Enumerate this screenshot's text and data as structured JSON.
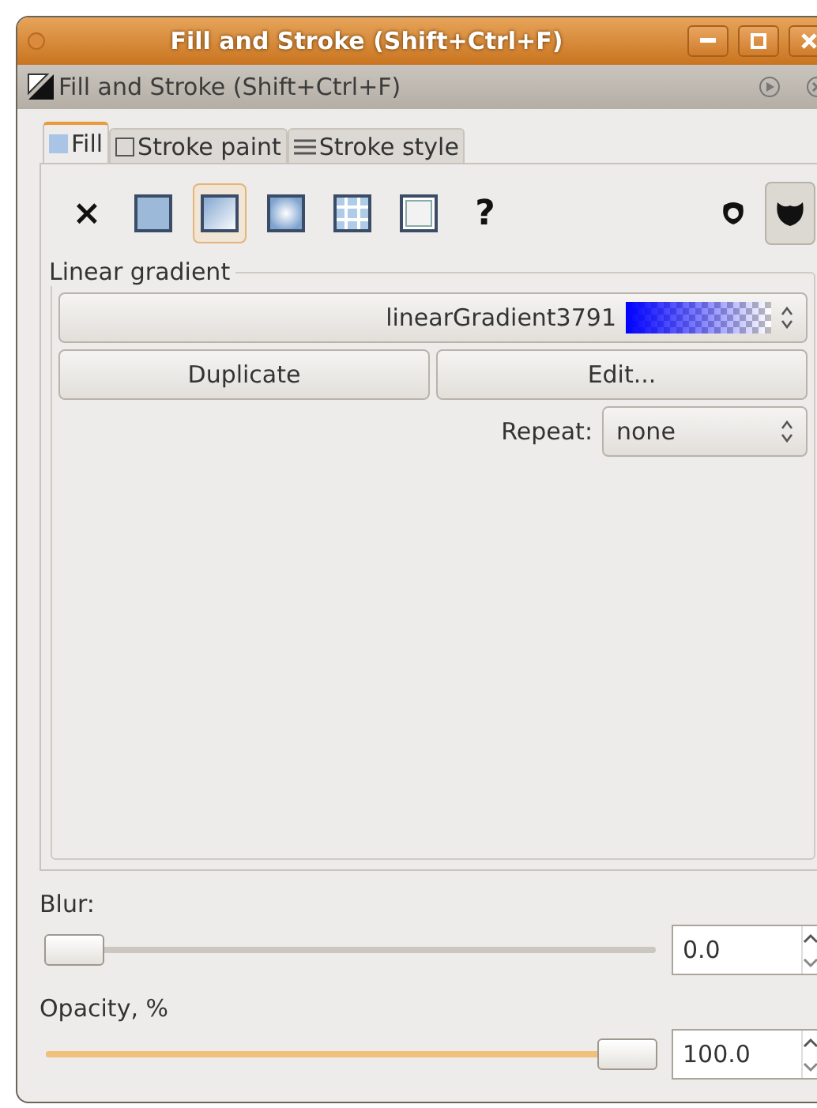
{
  "window": {
    "title": "Fill and Stroke (Shift+Ctrl+F)"
  },
  "dock": {
    "title": "Fill and Stroke (Shift+Ctrl+F)"
  },
  "tabs": [
    {
      "label": "Fill",
      "kind": "fill",
      "selected": true
    },
    {
      "label": "Stroke paint",
      "kind": "paint",
      "selected": false
    },
    {
      "label": "Stroke style",
      "kind": "style",
      "selected": false
    }
  ],
  "paint_types": [
    {
      "kind": "none",
      "label": "×",
      "selected": false
    },
    {
      "kind": "flat",
      "selected": false
    },
    {
      "kind": "linear",
      "selected": true
    },
    {
      "kind": "radial",
      "selected": false
    },
    {
      "kind": "pattern",
      "selected": false
    },
    {
      "kind": "swatch",
      "selected": false
    },
    {
      "kind": "unset",
      "label": "?",
      "selected": false
    }
  ],
  "fill_rules": [
    {
      "kind": "evenodd",
      "selected": false
    },
    {
      "kind": "nonzero",
      "selected": true
    }
  ],
  "gradient": {
    "frame_label": "Linear gradient",
    "name": "linearGradient3791",
    "color": "#0000ff",
    "buttons": [
      "Duplicate",
      "Edit..."
    ],
    "repeat_label": "Repeat:",
    "repeat_value": "none"
  },
  "blur": {
    "label": "Blur:",
    "level": 0,
    "value": "0.0"
  },
  "opacity": {
    "label": "Opacity, %",
    "level": 1,
    "value": "100.0"
  }
}
